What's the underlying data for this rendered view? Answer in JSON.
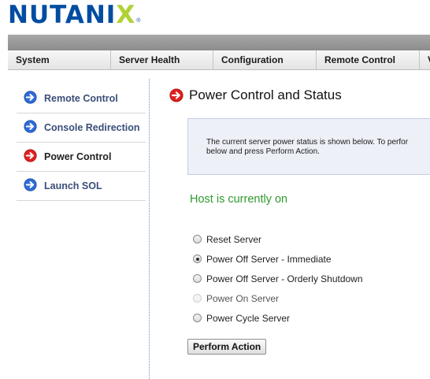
{
  "logo": {
    "text_main": "NUTANI",
    "text_x": "X",
    "reg": "®"
  },
  "menu": {
    "items": [
      {
        "label": "System"
      },
      {
        "label": "Server Health"
      },
      {
        "label": "Configuration"
      },
      {
        "label": "Remote Control"
      },
      {
        "label": "V"
      }
    ]
  },
  "sidebar": {
    "items": [
      {
        "label": "Remote Control",
        "icon": "blue-arrow-icon"
      },
      {
        "label": "Console Redirection",
        "icon": "blue-arrow-icon"
      },
      {
        "label": "Power Control",
        "icon": "red-arrow-icon",
        "active": true
      },
      {
        "label": "Launch SOL",
        "icon": "blue-arrow-icon"
      }
    ]
  },
  "main": {
    "title": "Power Control and Status",
    "info_line1": "The current server power status is shown below. To perfor",
    "info_line2": "below and press Perform Action.",
    "host_status": "Host is currently on",
    "options": [
      {
        "label": "Reset Server",
        "checked": false,
        "disabled": false
      },
      {
        "label": "Power Off Server - Immediate",
        "checked": true,
        "disabled": false
      },
      {
        "label": "Power Off Server - Orderly Shutdown",
        "checked": false,
        "disabled": false
      },
      {
        "label": "Power On Server",
        "checked": false,
        "disabled": true
      },
      {
        "label": "Power Cycle Server",
        "checked": false,
        "disabled": false
      }
    ],
    "action_button": "Perform Action"
  },
  "colors": {
    "brand_blue": "#024da1",
    "brand_green": "#b0d235",
    "status_green": "#2e9a2e",
    "arrow_blue": "#2e6bd6",
    "arrow_red": "#e0201f"
  }
}
